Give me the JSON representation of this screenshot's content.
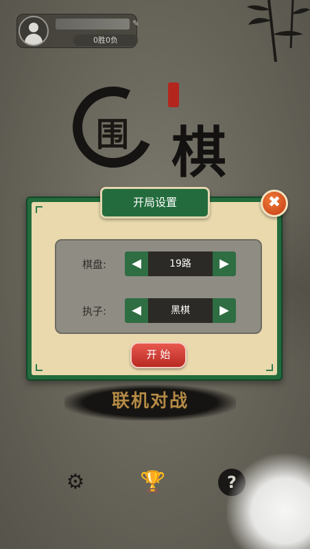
{
  "profile": {
    "record": "0胜0负"
  },
  "logo": {
    "char_wei": "围",
    "char_qi": "棋"
  },
  "dialog": {
    "title": "开局设置",
    "close_label": "✖",
    "board_label": "棋盘:",
    "board_value": "19路",
    "side_label": "执子:",
    "side_value": "黑棋",
    "start_label": "开 始"
  },
  "online_battle_label": "联机对战",
  "icons": {
    "settings": "gear-icon",
    "trophy": "trophy-icon",
    "help": "help-icon"
  },
  "colors": {
    "dialog_green": "#236b3c",
    "dialog_cream": "#e9d9ad",
    "start_red": "#d9433a",
    "close_orange": "#e2602a",
    "online_gold": "#b48a45"
  }
}
